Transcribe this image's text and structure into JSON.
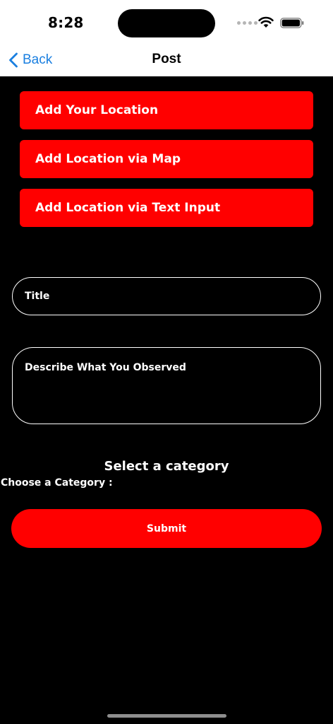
{
  "status_bar": {
    "time": "8:28",
    "icons": [
      "signal-dots-icon",
      "wifi-icon",
      "battery-icon"
    ]
  },
  "nav": {
    "back_label": "Back",
    "title": "Post",
    "back_color": "#1a7fe0"
  },
  "location_buttons": {
    "add_location": "Add Your Location",
    "via_map": "Add Location via Map",
    "via_text": "Add Location via Text Input"
  },
  "form": {
    "title_placeholder": "Title",
    "describe_placeholder": "Describe What You Observed",
    "category_heading": "Select a category",
    "category_label": "Choose a Category :"
  },
  "submit_label": "Submit",
  "colors": {
    "accent": "#ff0000",
    "background": "#000000",
    "text": "#ffffff"
  }
}
